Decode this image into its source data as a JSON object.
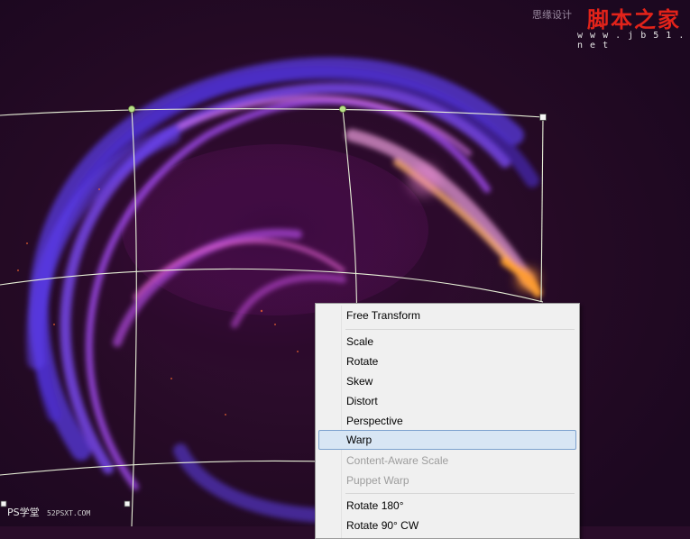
{
  "watermark": {
    "cn_site": "脚本之家",
    "url": "w w w . j b 5 1 . n e t",
    "small_text": "思缘设计"
  },
  "logo": {
    "name": "PS学堂",
    "url": "52PSXT.COM"
  },
  "context_menu": {
    "items": [
      {
        "label": "Free Transform",
        "enabled": true
      },
      {
        "label": "Scale",
        "enabled": true
      },
      {
        "label": "Rotate",
        "enabled": true
      },
      {
        "label": "Skew",
        "enabled": true
      },
      {
        "label": "Distort",
        "enabled": true
      },
      {
        "label": "Perspective",
        "enabled": true
      },
      {
        "label": "Warp",
        "enabled": true,
        "highlighted": true
      },
      {
        "label": "Content-Aware Scale",
        "enabled": false
      },
      {
        "label": "Puppet Warp",
        "enabled": false
      },
      {
        "label": "Rotate 180°",
        "enabled": true
      },
      {
        "label": "Rotate 90° CW",
        "enabled": true
      }
    ]
  },
  "colors": {
    "background": "#2a0c2a",
    "highlight": "#d8e6f4",
    "highlight_border": "#7da2ce",
    "warp_grid": "#e8f0d8",
    "handle_point": "#b8e088"
  }
}
